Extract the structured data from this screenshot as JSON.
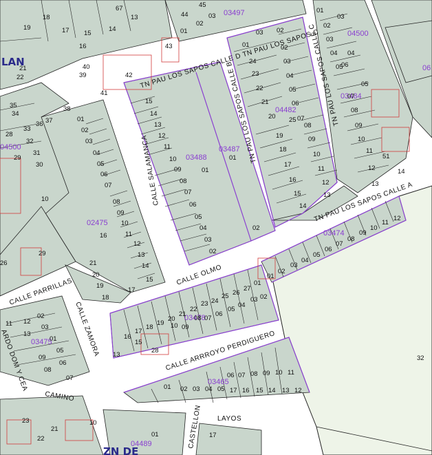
{
  "colors": {
    "parcel_fill": "#c9d6cc",
    "road_fill": "#ffffff",
    "green_area": "#eef4e8",
    "parcel_line": "#222222",
    "block_outline": "#8a3fd0",
    "building_line": "#d23b3b",
    "block_label": "#8a3fd0"
  },
  "area_labels": {
    "lan": "LAN",
    "zn_de": "ZN DE"
  },
  "streets": {
    "calle_d": "TN PAU LOS SAPOS CALLE  D TN PAU LOS SAPOS C",
    "calle_b": "TN PAU LOS SAPOS CALLE B",
    "calle_c": "TN PAU LOS SAPOS CALLE C",
    "calle_a": "TN PAU LOS SAPOS CALLE  A",
    "salamanca": "CALLE  SALAMANCA",
    "olmo": "CALLE  OLMO",
    "parrillas": "CALLE  PARRILLAS",
    "zamora": "CALLE  ZAMORA",
    "arroyo": "CALLE  ARRROYO PERDIGUERO",
    "camino": "CAMINO",
    "layos": "LAYOS",
    "castellon": "CASTELLON",
    "dom_y_cea": "ARDO DOM Y CEA"
  },
  "block_labels": {
    "b03497": "03497",
    "b04500a": "04500",
    "b03484": "03484",
    "b04482": "04482",
    "b03488": "03488",
    "b03487": "03487",
    "b04500b": "04500",
    "b02475": "02475",
    "b03474": "03474",
    "b03478": "03478",
    "b03475": "03475",
    "b03465": "03465",
    "b04489": "04489",
    "b06": "06"
  },
  "lot_numbers": {
    "n44": "44",
    "n45": "45",
    "n67": "67",
    "n03a": "03",
    "n13": "13",
    "n18": "18",
    "n02a": "02",
    "n19": "19",
    "n17": "17",
    "n15": "15",
    "n14": "14",
    "n16": "16",
    "n43": "43",
    "n40": "40",
    "n39": "39",
    "n42": "42",
    "n41": "41",
    "n21": "21",
    "n22": "22",
    "n01a": "01",
    "n02b": "02",
    "n03b": "03",
    "n01b": "01",
    "n02c": "02",
    "n03c": "03",
    "n04a": "04",
    "n05a": "05",
    "n06a": "06",
    "n24a": "24",
    "n23a": "23",
    "n22a": "22",
    "n21a": "21",
    "n20a": "20",
    "n25a": "25",
    "n03d": "03",
    "n04b": "04",
    "n05b": "05",
    "n06b": "06",
    "n07a": "07",
    "n08a": "08",
    "n09a": "09",
    "n10a": "10",
    "n11a": "11",
    "n12a": "12",
    "n13a": "13",
    "n14a": "14",
    "n01c": "01",
    "n02d": "02",
    "n03e": "03",
    "n04c": "04",
    "n05c": "05",
    "n06c": "06",
    "n07b": "07",
    "n08b": "08",
    "n09b": "09",
    "n10b": "10",
    "n11b": "11",
    "n12b": "12",
    "n13b": "13",
    "n14b": "14",
    "n51": "51",
    "n19a": "19",
    "n18a": "18",
    "n17a": "17",
    "n16a": "16",
    "n15a": "15",
    "n14c": "14",
    "n08c": "08",
    "n09c": "09",
    "n10c": "10",
    "n11c": "11",
    "n12c": "12",
    "n13c": "13",
    "n15b": "15",
    "n14d": "14",
    "n13d": "13",
    "n12d": "12",
    "n11d": "11",
    "n10d": "10",
    "n09d": "09",
    "n08d": "08",
    "n07c": "07",
    "n06d": "06",
    "n05d": "05",
    "n04d": "04",
    "n03f": "03",
    "n02e": "02",
    "n01d": "01",
    "n02f": "02",
    "n01e": "01",
    "n02g": "02",
    "n03g": "03",
    "n04e": "04",
    "n05e": "05",
    "n06e": "06",
    "n07d": "07",
    "n08e": "08",
    "n09e": "09",
    "n10e": "10",
    "n11e": "11",
    "n12e": "12",
    "n13e": "13",
    "n14e": "14",
    "n15c": "15",
    "n16b": "16",
    "n17b": "17",
    "n10f": "10",
    "n35": "35",
    "n34": "34",
    "n38": "38",
    "n36": "36",
    "n37": "37",
    "n33": "33",
    "n32": "32",
    "n31": "31",
    "n28": "28",
    "n29": "29",
    "n30": "30",
    "n23b": "23",
    "n29b": "29",
    "n26": "26",
    "n21b": "21",
    "n20b": "20",
    "n19b": "19",
    "n18b": "18",
    "n01f": "01",
    "n02h": "02",
    "n03h": "03",
    "n04f": "04",
    "n05f": "05",
    "n06f": "06",
    "n07e": "07",
    "n08f": "08",
    "n09f": "09",
    "n10g": "10",
    "n11f": "11",
    "n12f": "12",
    "n27": "27",
    "n26b": "26",
    "n25b": "25",
    "n24b": "24",
    "n23c": "23",
    "n22b": "22",
    "n21c": "21",
    "n20c": "20",
    "n19c": "19",
    "n18c": "18",
    "n17c": "17",
    "n16c": "16",
    "n15d": "15",
    "n10h": "10",
    "n09g": "09",
    "n08g": "08",
    "n07f": "07",
    "n06g": "06",
    "n05g": "05",
    "n04g": "04",
    "n03i": "03",
    "n02i": "02",
    "n01g": "01",
    "n13f": "13",
    "n28b": "28",
    "n32big": "32",
    "n11g": "11",
    "n12g": "12",
    "n13g": "13",
    "n02j": "02",
    "n03j": "03",
    "n01h": "01",
    "n09h": "09",
    "n05h": "05",
    "n06h": "06",
    "n08h": "08",
    "n07g": "07",
    "n01i": "01",
    "n02k": "02",
    "n03k": "03",
    "n04h": "04",
    "n05i": "05",
    "n06i": "06",
    "n07h": "07",
    "n08i": "08",
    "n09i": "09",
    "n10i": "10",
    "n11h": "11",
    "n17d": "17",
    "n16d": "16",
    "n15e": "15",
    "n14f": "14",
    "n13h": "13",
    "n12h": "12",
    "n23d": "23",
    "n22c": "22",
    "n21d": "21",
    "n01j": "01",
    "n17e": "17",
    "n10j": "10"
  }
}
